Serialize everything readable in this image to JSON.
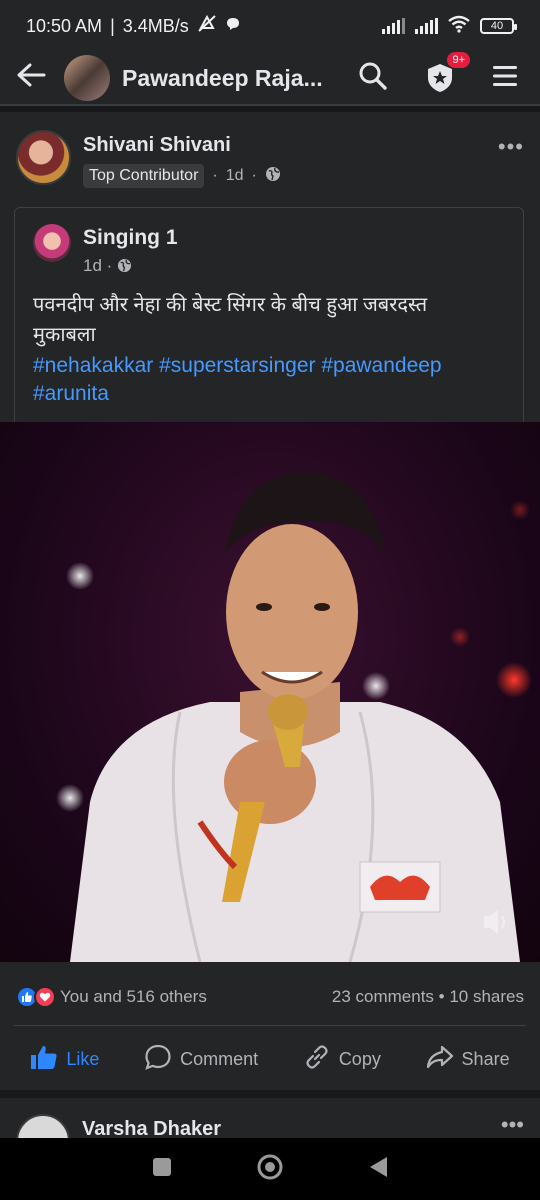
{
  "status": {
    "time": "10:50 AM",
    "speed": "3.4MB/s",
    "battery": "40"
  },
  "header": {
    "title": "Pawandeep Raja...",
    "notifications_badge": "9+"
  },
  "post": {
    "author": "Shivani Shivani",
    "badge": "Top Contributor",
    "time": "1d",
    "shared": {
      "author": "Singing 1",
      "time": "1d",
      "text": "पवनदीप और नेहा की बेस्ट सिंगर के बीच हुआ जबरदस्त मुकाबला",
      "hashtags": "#nehakakkar #superstarsinger #pawandeep #arunita"
    },
    "reactions": {
      "summary": "You and 516 others",
      "stats": "23 comments • 10 shares"
    },
    "actions": {
      "like": "Like",
      "comment": "Comment",
      "copy": "Copy",
      "share": "Share"
    }
  },
  "next_post": {
    "author": "Varsha Dhaker"
  },
  "colors": {
    "accent": "#2d88ff",
    "hashtag": "#4599ff",
    "background": "#242526"
  }
}
